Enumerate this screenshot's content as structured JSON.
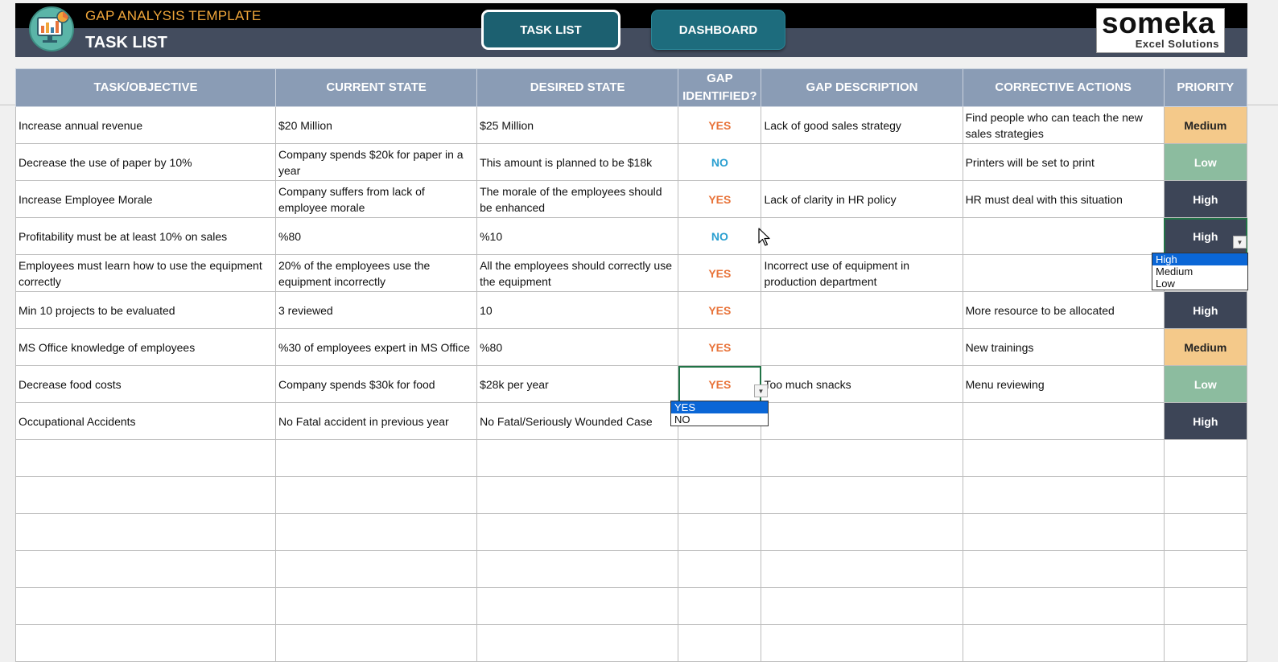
{
  "header": {
    "app_title": "GAP ANALYSIS TEMPLATE",
    "page_title": "TASK LIST",
    "nav": {
      "task_list": "TASK LIST",
      "dashboard": "DASHBOARD"
    },
    "brand": {
      "name": "someka",
      "sub": "Excel Solutions"
    }
  },
  "columns": [
    "TASK/OBJECTIVE",
    "CURRENT STATE",
    "DESIRED STATE",
    "GAP IDENTIFIED?",
    "GAP DESCRIPTION",
    "CORRECTIVE ACTIONS",
    "PRIORITY"
  ],
  "rows": [
    {
      "task": "Increase annual revenue",
      "current": "$20 Million",
      "desired": "$25 Million",
      "gap": "YES",
      "gap_desc": "Lack of good sales strategy",
      "actions": "Find people who can teach the new sales strategies",
      "priority": "Medium"
    },
    {
      "task": "Decrease the use of paper by 10%",
      "current": "Company spends $20k for paper in a year",
      "desired": "This amount is planned to be $18k",
      "gap": "NO",
      "gap_desc": "",
      "actions": "Printers will be set to print",
      "priority": "Low"
    },
    {
      "task": "Increase Employee Morale",
      "current": "Company suffers from lack of employee morale",
      "desired": "The morale of the employees should be enhanced",
      "gap": "YES",
      "gap_desc": "Lack of clarity in HR policy",
      "actions": "HR must deal with this situation",
      "priority": "High"
    },
    {
      "task": "Profitability must be at least 10% on sales",
      "current": "%80",
      "desired": "%10",
      "gap": "NO",
      "gap_desc": "",
      "actions": "",
      "priority": "High"
    },
    {
      "task": "Employees must learn how to use the equipment correctly",
      "current": "20% of the employees use the equipment incorrectly",
      "desired": "All the employees should correctly use the equipment",
      "gap": "YES",
      "gap_desc": "Incorrect use of equipment in production department",
      "actions": "",
      "priority": ""
    },
    {
      "task": "Min 10 projects to be evaluated",
      "current": "3 reviewed",
      "desired": "10",
      "gap": "YES",
      "gap_desc": "",
      "actions": "More resource to be allocated",
      "priority": "High"
    },
    {
      "task": "MS Office knowledge of employees",
      "current": "%30 of employees expert in MS Office",
      "desired": "%80",
      "gap": "YES",
      "gap_desc": "",
      "actions": "New trainings",
      "priority": "Medium"
    },
    {
      "task": "Decrease food costs",
      "current": "Company spends $30k for food",
      "desired": "$28k per year",
      "gap": "YES",
      "gap_desc": "Too much snacks",
      "actions": "Menu reviewing",
      "priority": "Low"
    },
    {
      "task": "Occupational Accidents",
      "current": "No Fatal accident in previous year",
      "desired": "No Fatal/Seriously Wounded Case",
      "gap": "",
      "gap_desc": "",
      "actions": "",
      "priority": "High"
    }
  ],
  "empty_rows": 6,
  "selected_cells": [
    {
      "row": 3,
      "col": "priority"
    },
    {
      "row": 7,
      "col": "gap"
    }
  ],
  "dropdowns": {
    "priority": {
      "options": [
        "High",
        "Medium",
        "Low"
      ],
      "selected": "High"
    },
    "gap": {
      "options": [
        "YES",
        "NO"
      ],
      "selected": "YES"
    }
  },
  "colors": {
    "header_black": "#000000",
    "header_slate": "#434c5e",
    "app_title": "#f0a63a",
    "nav_button": "#1c6070",
    "table_header": "#8a9cb5",
    "gap_yes": "#e8743b",
    "gap_no": "#2a9fd0",
    "priority_high": "#3d4557",
    "priority_medium": "#f4c98a",
    "priority_low": "#8cbc9f",
    "selection": "#217346"
  },
  "icons": {
    "logo": "dashboard-chart-icon",
    "dropdown": "dropdown-arrow-icon",
    "cursor": "mouse-pointer-icon"
  }
}
